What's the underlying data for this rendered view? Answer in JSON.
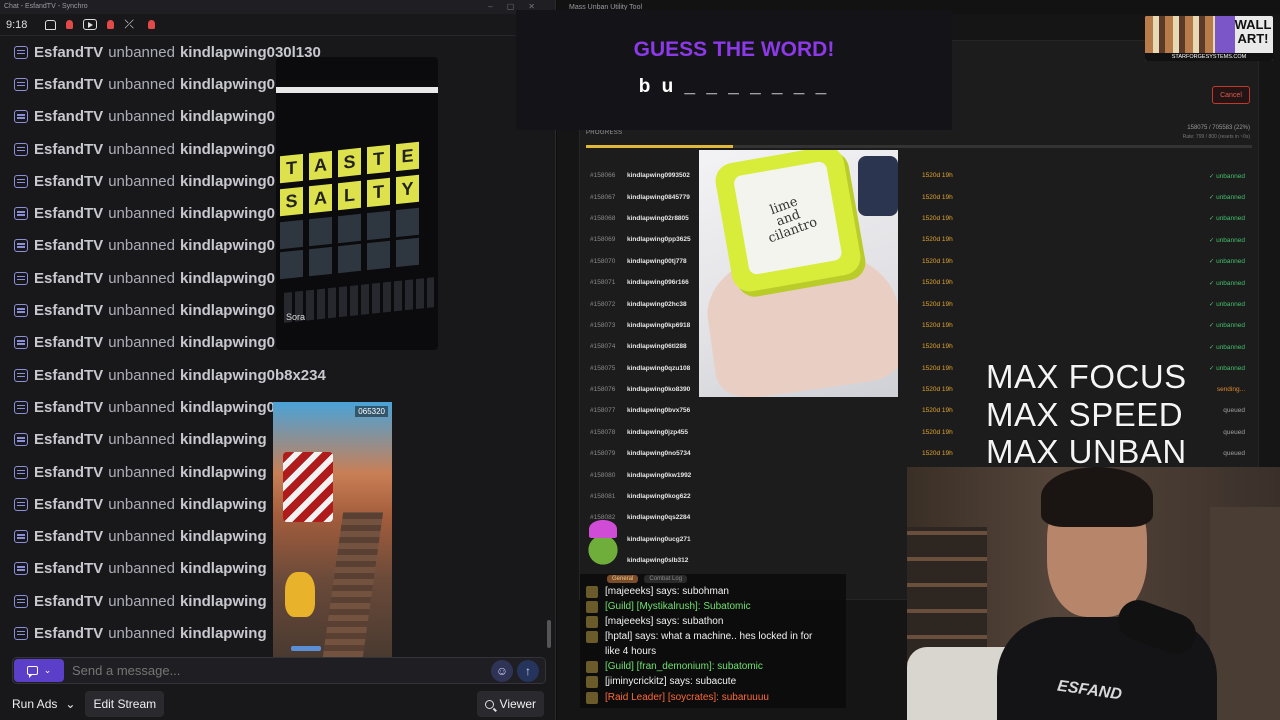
{
  "chat_window": {
    "title": "Chat - EsfandTV - Synchro",
    "time": "9:18",
    "messages": [
      {
        "user": "EsfandTV",
        "action": "unbanned",
        "target": "kindlapwing030l130"
      },
      {
        "user": "EsfandTV",
        "action": "unbanned",
        "target": "kindlapwing0"
      },
      {
        "user": "EsfandTV",
        "action": "unbanned",
        "target": "kindlapwing0"
      },
      {
        "user": "EsfandTV",
        "action": "unbanned",
        "target": "kindlapwing0"
      },
      {
        "user": "EsfandTV",
        "action": "unbanned",
        "target": "kindlapwing0"
      },
      {
        "user": "EsfandTV",
        "action": "unbanned",
        "target": "kindlapwing0"
      },
      {
        "user": "EsfandTV",
        "action": "unbanned",
        "target": "kindlapwing0"
      },
      {
        "user": "EsfandTV",
        "action": "unbanned",
        "target": "kindlapwing0"
      },
      {
        "user": "EsfandTV",
        "action": "unbanned",
        "target": "kindlapwing0"
      },
      {
        "user": "EsfandTV",
        "action": "unbanned",
        "target": "kindlapwing0"
      },
      {
        "user": "EsfandTV",
        "action": "unbanned",
        "target": "kindlapwing0b8x234"
      },
      {
        "user": "EsfandTV",
        "action": "unbanned",
        "target": "kindlapwing0"
      },
      {
        "user": "EsfandTV",
        "action": "unbanned",
        "target": "kindlapwing"
      },
      {
        "user": "EsfandTV",
        "action": "unbanned",
        "target": "kindlapwing"
      },
      {
        "user": "EsfandTV",
        "action": "unbanned",
        "target": "kindlapwing"
      },
      {
        "user": "EsfandTV",
        "action": "unbanned",
        "target": "kindlapwing"
      },
      {
        "user": "EsfandTV",
        "action": "unbanned",
        "target": "kindlapwing"
      },
      {
        "user": "EsfandTV",
        "action": "unbanned",
        "target": "kindlapwing"
      },
      {
        "user": "EsfandTV",
        "action": "unbanned",
        "target": "kindlapwing"
      }
    ],
    "input_placeholder": "Send a message...",
    "run_ads_label": "Run Ads",
    "edit_stream_label": "Edit Stream",
    "viewer_label": "Viewer"
  },
  "wordle_video": {
    "row1": [
      "T",
      "A",
      "S",
      "T",
      "E"
    ],
    "row2": [
      "S",
      "A",
      "L",
      "T",
      "Y"
    ],
    "tag": "Sora"
  },
  "subway_video": {
    "score": "065320"
  },
  "guess_game": {
    "title": "GUESS THE WORD!",
    "word": "b u _ _ _ _ _ _ _"
  },
  "tool": {
    "title": "Mass Unban Utility Tool",
    "cancel_label": "Cancel",
    "progress_label": "PROGRESS",
    "progress_count": "158075 / 705583 (22%)",
    "progress_rate": "Rate: 799 / 800 (resets in ~0s)",
    "progress_fraction": 0.22,
    "rows": [
      {
        "idx": "#158066",
        "name": "kindlapwing0993502",
        "dur": "1520d 19h",
        "status": "✓ unbanned",
        "kind": "ok"
      },
      {
        "idx": "#158067",
        "name": "kindlapwing0845779",
        "dur": "1520d 19h",
        "status": "✓ unbanned",
        "kind": "ok"
      },
      {
        "idx": "#158068",
        "name": "kindlapwing02r8805",
        "dur": "1520d 19h",
        "status": "✓ unbanned",
        "kind": "ok"
      },
      {
        "idx": "#158069",
        "name": "kindlapwing0pp3625",
        "dur": "1520d 19h",
        "status": "✓ unbanned",
        "kind": "ok"
      },
      {
        "idx": "#158070",
        "name": "kindlapwing00tj778",
        "dur": "1520d 19h",
        "status": "✓ unbanned",
        "kind": "ok"
      },
      {
        "idx": "#158071",
        "name": "kindlapwing096r166",
        "dur": "1520d 19h",
        "status": "✓ unbanned",
        "kind": "ok"
      },
      {
        "idx": "#158072",
        "name": "kindlapwing02hc38",
        "dur": "1520d 19h",
        "status": "✓ unbanned",
        "kind": "ok"
      },
      {
        "idx": "#158073",
        "name": "kindlapwing0kp6918",
        "dur": "1520d 19h",
        "status": "✓ unbanned",
        "kind": "ok"
      },
      {
        "idx": "#158074",
        "name": "kindlapwing06tl288",
        "dur": "1520d 19h",
        "status": "✓ unbanned",
        "kind": "ok"
      },
      {
        "idx": "#158075",
        "name": "kindlapwing0qzu108",
        "dur": "1520d 19h",
        "status": "✓ unbanned",
        "kind": "ok"
      },
      {
        "idx": "#158076",
        "name": "kindlapwing0ko8390",
        "dur": "1520d 19h",
        "status": "sending...",
        "kind": "sending"
      },
      {
        "idx": "#158077",
        "name": "kindlapwing0bvx756",
        "dur": "1520d 19h",
        "status": "queued",
        "kind": "queued"
      },
      {
        "idx": "#158078",
        "name": "kindlapwing0jzp455",
        "dur": "1520d 19h",
        "status": "queued",
        "kind": "queued"
      },
      {
        "idx": "#158079",
        "name": "kindlapwing0no5734",
        "dur": "1520d 19h",
        "status": "queued",
        "kind": "queued"
      },
      {
        "idx": "#158080",
        "name": "kindlapwing0kw1992",
        "dur": "",
        "status": "",
        "kind": "queued"
      },
      {
        "idx": "#158081",
        "name": "kindlapwing0kog622",
        "dur": "",
        "status": "",
        "kind": "queued"
      },
      {
        "idx": "#158082",
        "name": "kindlapwing0qs2284",
        "dur": "",
        "status": "",
        "kind": "queued"
      },
      {
        "idx": "",
        "name": "kindlapwing0ucg271",
        "dur": "",
        "status": "",
        "kind": "queued"
      },
      {
        "idx": "",
        "name": "kindlapwing0slb312",
        "dur": "",
        "status": "",
        "kind": "queued"
      }
    ]
  },
  "cube_video": {
    "label": "lime\nand\ncilantro"
  },
  "wall_art": {
    "text": "WALL\nART!",
    "sub": "STARFORGESYSTEMS.COM"
  },
  "max_text": [
    "MAX FOCUS",
    "MAX SPEED",
    "MAX UNBAN"
  ],
  "webcam": {
    "shirt_text": "ESFAND"
  },
  "stream_chat": {
    "tabs": [
      "General",
      "Combat Log"
    ],
    "lines": [
      {
        "text": "[majeeeks] says: subohman",
        "kind": "say"
      },
      {
        "text": "[Guild] [Mystikalrush]: Subatomic",
        "kind": "guild"
      },
      {
        "text": "[majeeeks] says: subathon",
        "kind": "say"
      },
      {
        "text": "[hptal] says:  what a machine.. hes locked in for",
        "kind": "say"
      },
      {
        "text": "like 4 hours",
        "kind": "say"
      },
      {
        "text": "[Guild] [fran_demonium]: subatomic",
        "kind": "guild"
      },
      {
        "text": "[jiminycrickitz] says: subacute",
        "kind": "say"
      },
      {
        "text": "[Raid Leader] [soycrates]: subaruuuu",
        "kind": "raid"
      }
    ]
  }
}
